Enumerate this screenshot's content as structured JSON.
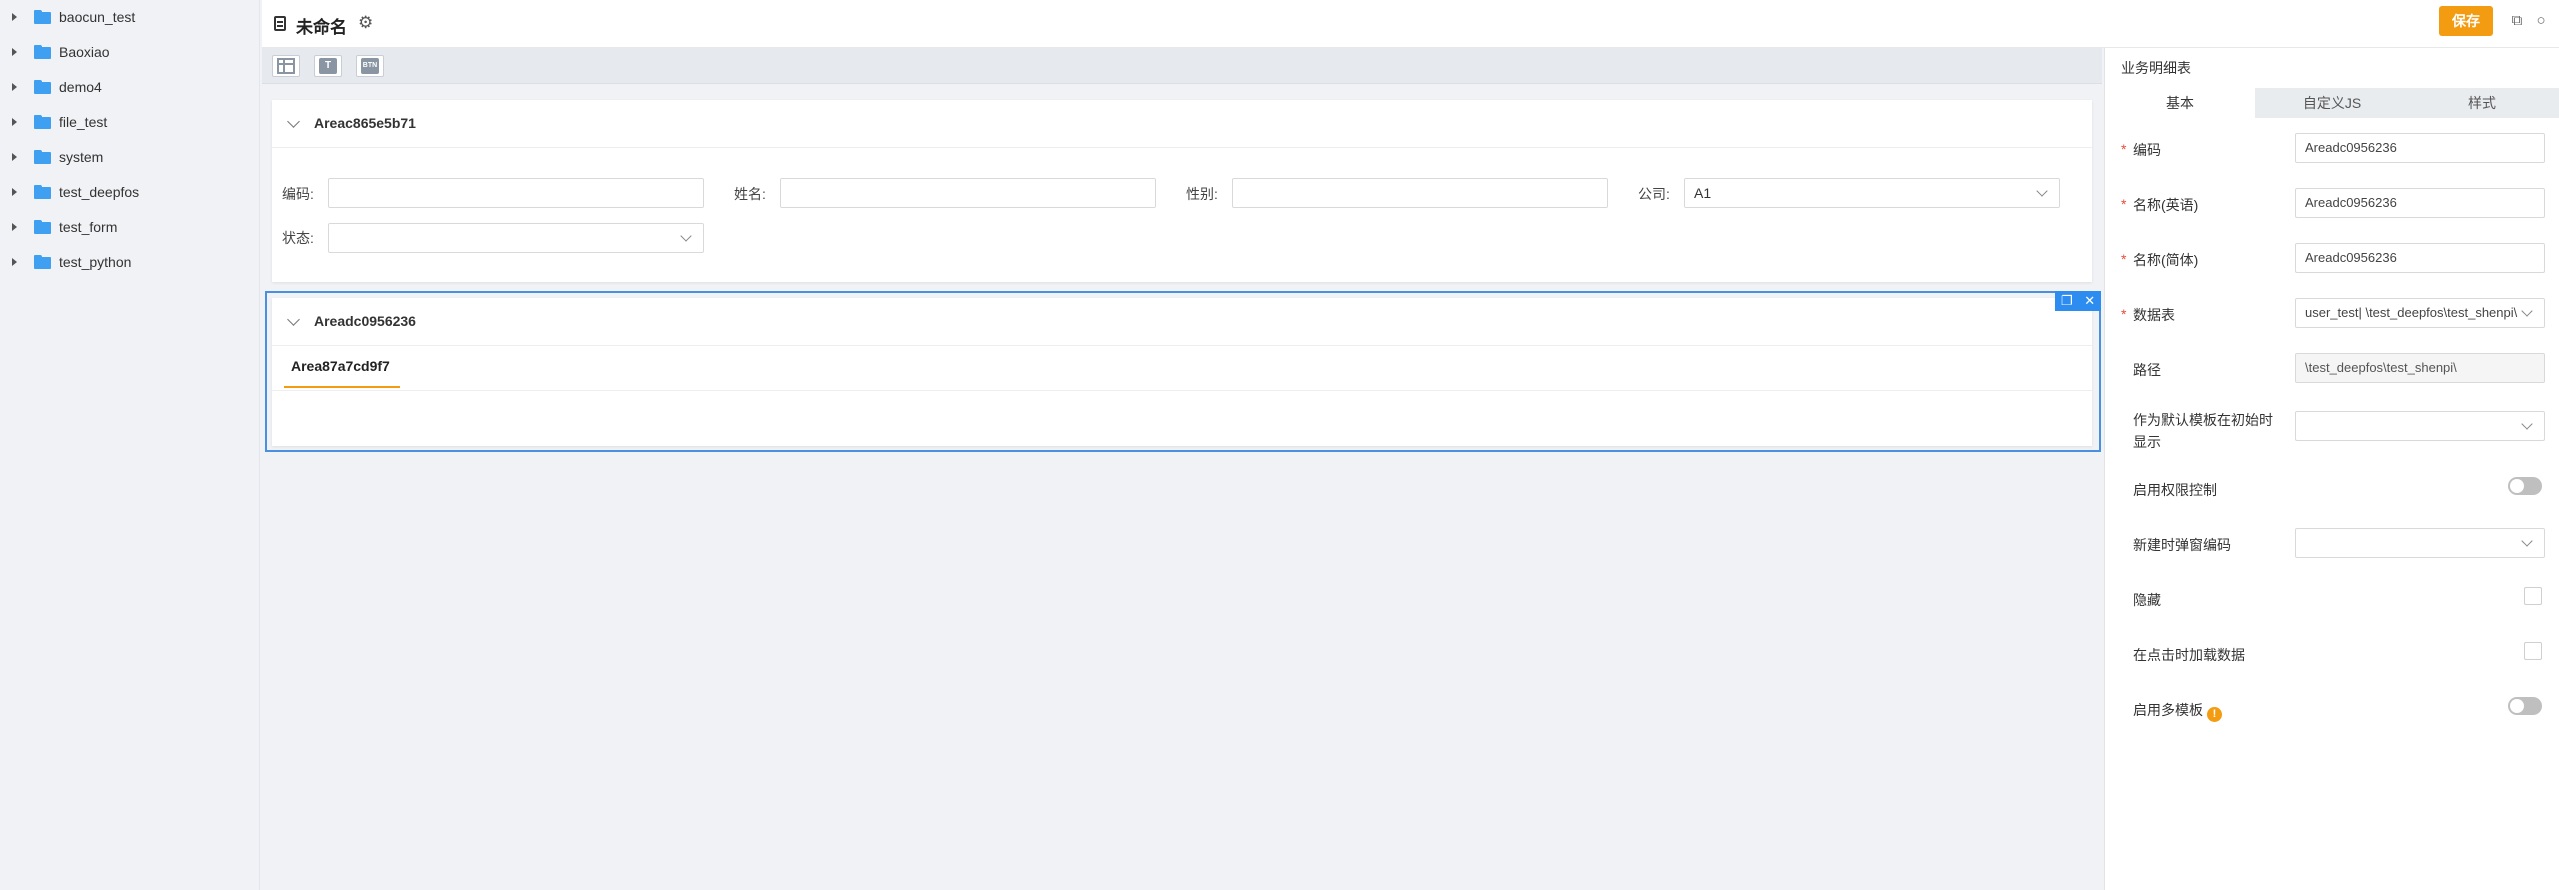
{
  "sidebar": {
    "items": [
      {
        "label": "baocun_test"
      },
      {
        "label": "Baoxiao"
      },
      {
        "label": "demo4"
      },
      {
        "label": "file_test"
      },
      {
        "label": "system"
      },
      {
        "label": "test_deepfos"
      },
      {
        "label": "test_form"
      },
      {
        "label": "test_python"
      }
    ]
  },
  "header": {
    "title": "未命名",
    "save_label": "保存"
  },
  "toolbar": {
    "text_button": "T",
    "btn_button": "BTN"
  },
  "area1": {
    "title": "Areac865e5b71",
    "fields": {
      "code_label": "编码:",
      "name_label": "姓名:",
      "gender_label": "性别:",
      "company_label": "公司:",
      "company_value": "A1",
      "status_label": "状态:"
    }
  },
  "area2": {
    "title": "Areadc0956236",
    "tab_label": "Area87a7cd9f7"
  },
  "panel": {
    "title": "业务明细表",
    "tabs": [
      "基本",
      "自定义JS",
      "样式"
    ],
    "rows": {
      "code": {
        "label": "编码",
        "value": "Areadc0956236"
      },
      "name_en": {
        "label": "名称(英语)",
        "value": "Areadc0956236"
      },
      "name_zh": {
        "label": "名称(简体)",
        "value": "Areadc0956236"
      },
      "table": {
        "label": "数据表",
        "value": "user_test| \\test_deepfos\\test_shenpi\\"
      },
      "path": {
        "label": "路径",
        "value": "\\test_deepfos\\test_shenpi\\"
      },
      "default_template": {
        "label": "作为默认模板在初始时显示"
      },
      "permission": {
        "label": "启用权限控制"
      },
      "popup_code": {
        "label": "新建时弹窗编码"
      },
      "hidden": {
        "label": "隐藏"
      },
      "load_on_click": {
        "label": "在点击时加载数据"
      },
      "multi_template": {
        "label": "启用多模板",
        "info": "!"
      }
    }
  }
}
